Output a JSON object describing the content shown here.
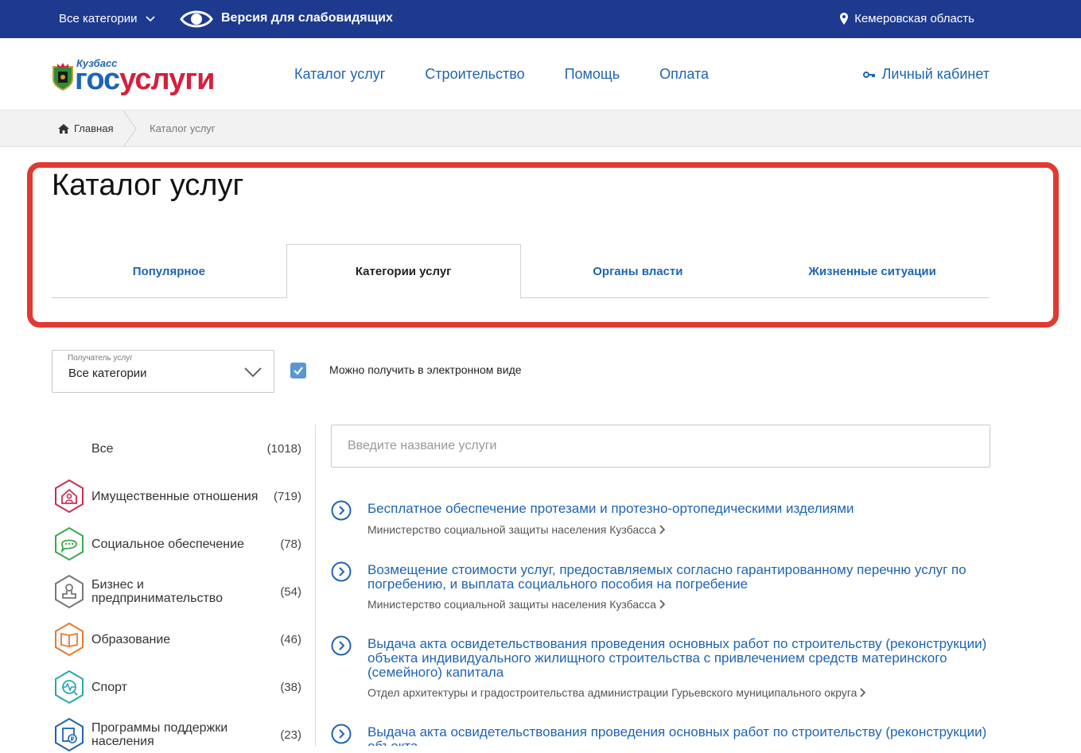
{
  "topbar": {
    "categories_label": "Все категории",
    "vision_label": "Версия для слабовидящих",
    "region_label": "Кемеровская область"
  },
  "logo": {
    "region": "Кузбасс",
    "brand_part1": "гос",
    "brand_part2": "услуги"
  },
  "nav": {
    "items": [
      "Каталог услуг",
      "Строительство",
      "Помощь",
      "Оплата"
    ],
    "account_label": "Личный кабинет"
  },
  "breadcrumb": {
    "home": "Главная",
    "current": "Каталог услуг"
  },
  "page": {
    "title": "Каталог услуг",
    "tabs": [
      {
        "label": "Популярное",
        "active": false
      },
      {
        "label": "Категории услуг",
        "active": true
      },
      {
        "label": "Органы власти",
        "active": false
      },
      {
        "label": "Жизненные ситуации",
        "active": false
      }
    ]
  },
  "filter": {
    "recipient_label": "Получатель услуг",
    "recipient_value": "Все категории",
    "electronic_label": "Можно получить в электронном виде",
    "electronic_checked": true
  },
  "categories": [
    {
      "name": "Все",
      "count": "(1018)",
      "icon": "none",
      "color": ""
    },
    {
      "name": "Имущественные отношения",
      "count": "(719)",
      "icon": "house-person-icon",
      "color": "#c8304f"
    },
    {
      "name": "Социальное обеспечение",
      "count": "(78)",
      "icon": "chat-bubble-icon",
      "color": "#3aa84a"
    },
    {
      "name": "Бизнес и предпринимательство",
      "count": "(54)",
      "icon": "stamp-icon",
      "color": "#777777"
    },
    {
      "name": "Образование",
      "count": "(46)",
      "icon": "book-icon",
      "color": "#e87a2a"
    },
    {
      "name": "Спорт",
      "count": "(38)",
      "icon": "pulse-icon",
      "color": "#2aa6b0"
    },
    {
      "name": "Программы поддержки населения",
      "count": "(23)",
      "icon": "ruble-document-icon",
      "color": "#1e64b4"
    }
  ],
  "search": {
    "placeholder": "Введите название услуги"
  },
  "services": [
    {
      "title": "Бесплатное обеспечение протезами и протезно-ортопедическими изделиями",
      "org": "Министерство социальной защиты населения Кузбасса"
    },
    {
      "title": "Возмещение стоимости услуг, предоставляемых согласно гарантированному перечню услуг по погребению, и выплата социального пособия на погребение",
      "org": "Министерство социальной защиты населения Кузбасса"
    },
    {
      "title": "Выдача акта освидетельствования проведения основных работ по строительству (реконструкции) объекта индивидуального жилищного строительства с привлечением средств материнского (семейного) капитала",
      "org": "Отдел архитектуры и градостроительства администрации Гурьевского муниципального округа"
    },
    {
      "title": "Выдача акта освидетельствования проведения основных работ по строительству (реконструкции) объекта",
      "org": ""
    }
  ],
  "colors": {
    "topbar": "#1e3a8f",
    "link": "#1e64b4",
    "highlight": "#e03a32",
    "checkbox": "#5a96d2"
  }
}
